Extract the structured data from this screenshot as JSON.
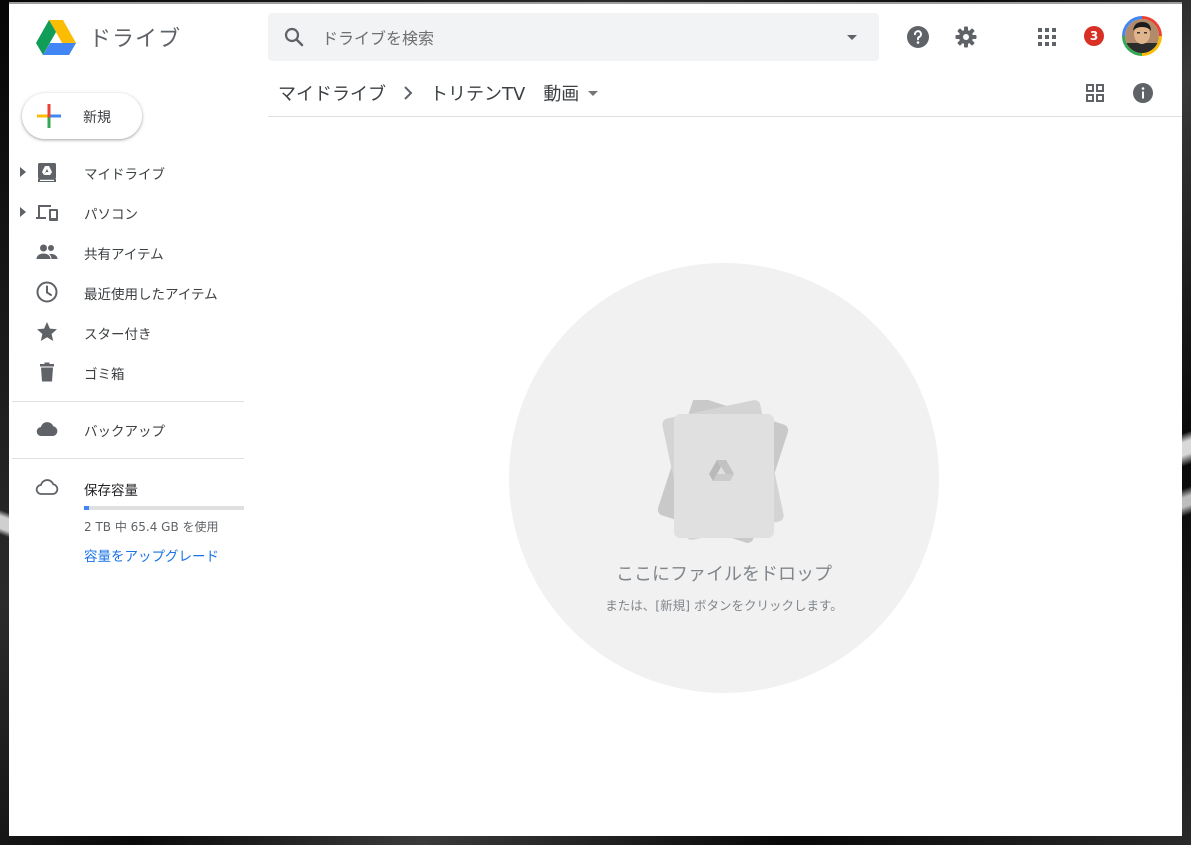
{
  "app": {
    "logo_text": "ドライブ"
  },
  "search": {
    "placeholder": "ドライブを検索",
    "value": ""
  },
  "header": {
    "notification_count": "3"
  },
  "sidebar": {
    "new_label": "新規",
    "items": [
      {
        "label": "マイドライブ",
        "icon": "my-drive-icon",
        "expandable": true
      },
      {
        "label": "パソコン",
        "icon": "computers-icon",
        "expandable": true
      },
      {
        "label": "共有アイテム",
        "icon": "people-icon",
        "expandable": false
      },
      {
        "label": "最近使用したアイテム",
        "icon": "clock-icon",
        "expandable": false
      },
      {
        "label": "スター付き",
        "icon": "star-icon",
        "expandable": false
      },
      {
        "label": "ゴミ箱",
        "icon": "trash-icon",
        "expandable": false
      }
    ],
    "backup_label": "バックアップ",
    "storage": {
      "title": "保存容量",
      "usage_text": "2 TB 中 65.4 GB を使用",
      "used_fraction": 0.032,
      "upgrade_label": "容量をアップグレード"
    }
  },
  "breadcrumb": {
    "items": [
      "マイドライブ",
      "トリテンTV",
      "動画"
    ]
  },
  "empty_state": {
    "title": "ここにファイルをドロップ",
    "subtitle": "または、[新規] ボタンをクリックします。"
  },
  "colors": {
    "accent_blue": "#1a73e8",
    "badge_red": "#d93025",
    "icon_gray": "#5f6368"
  }
}
